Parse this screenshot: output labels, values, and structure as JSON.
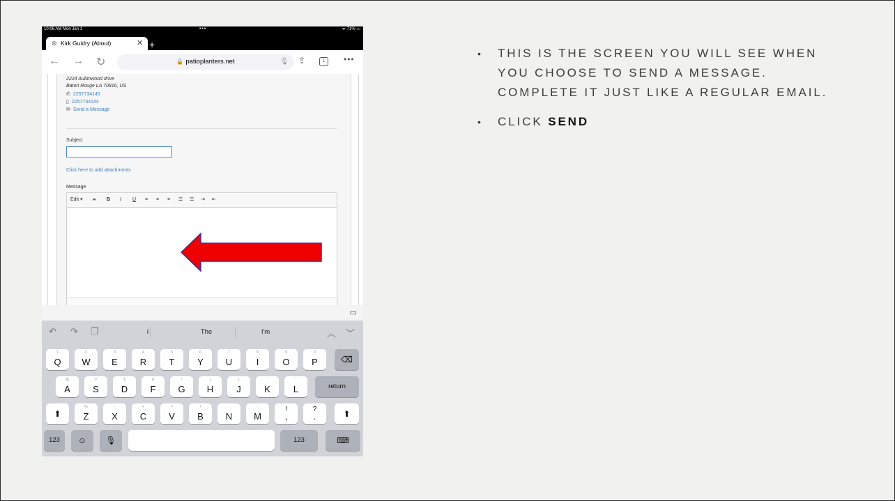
{
  "ipad": {
    "status": {
      "time": "10:06 AM  Mon Jan 1",
      "dots": "•••",
      "battery": "ᯤ 71% ▭"
    },
    "tab": {
      "title": "Kirk Guidry (About)",
      "close": "✕",
      "new_tab": "+"
    },
    "toolbar": {
      "back": "←",
      "forward": "→",
      "reload": "↻",
      "url": "patioplanters.net",
      "lock": "🔒",
      "mic": "🎙",
      "share": "⇪",
      "tab_count": "1",
      "more": "•••"
    },
    "contact": {
      "address_line1": "2224 Aubinwood drive",
      "address_line2": "Baton Rouge LA 70816, US",
      "phone": "2257734145",
      "mobile": "2257734144",
      "send_message": "Send a Message",
      "phone_icon": "✆",
      "mobile_icon": "▯",
      "mail_icon": "✉"
    },
    "form": {
      "subject_label": "Subject",
      "subject_value": "",
      "attach_link": "Click here to add attachments",
      "message_label": "Message",
      "edit_menu": "Edit ▾",
      "format_buttons": [
        "⨯̶",
        "B",
        "I",
        "U",
        "≡",
        "≡",
        "≡",
        "☰",
        "☰",
        "⇥",
        "⇤"
      ]
    },
    "keyboard": {
      "strip_icon": "▭",
      "undo": "↶",
      "redo": "↷",
      "paste": "❐",
      "suggestions": [
        "I",
        "The",
        "I'm"
      ],
      "nav_up": "︿",
      "nav_down": "﹀",
      "row1": [
        {
          "hint": "1",
          "key": "Q"
        },
        {
          "hint": "2",
          "key": "W"
        },
        {
          "hint": "3",
          "key": "E"
        },
        {
          "hint": "4",
          "key": "R"
        },
        {
          "hint": "5",
          "key": "T"
        },
        {
          "hint": "6",
          "key": "Y"
        },
        {
          "hint": "7",
          "key": "U"
        },
        {
          "hint": "8",
          "key": "I"
        },
        {
          "hint": "9",
          "key": "O"
        },
        {
          "hint": "0",
          "key": "P"
        }
      ],
      "delete": "⌫",
      "row2": [
        {
          "hint": "@",
          "key": "A"
        },
        {
          "hint": "#",
          "key": "S"
        },
        {
          "hint": "$",
          "key": "D"
        },
        {
          "hint": "&",
          "key": "F"
        },
        {
          "hint": "*",
          "key": "G"
        },
        {
          "hint": "(",
          "key": "H"
        },
        {
          "hint": ")",
          "key": "J"
        },
        {
          "hint": "'",
          "key": "K"
        },
        {
          "hint": "\"",
          "key": "L"
        }
      ],
      "return": "return",
      "row3": [
        {
          "hint": "%",
          "key": "Z"
        },
        {
          "hint": "-",
          "key": "X"
        },
        {
          "hint": "+",
          "key": "C"
        },
        {
          "hint": "=",
          "key": "V"
        },
        {
          "hint": "/",
          "key": "B"
        },
        {
          "hint": ";",
          "key": "N"
        },
        {
          "hint": ":",
          "key": "M"
        },
        {
          "hint": "!",
          "key": ","
        },
        {
          "hint": "?",
          "key": "."
        }
      ],
      "shift": "⬆",
      "numbers": "123",
      "emoji": "☺",
      "dictation": "🎙",
      "hide": "⌨"
    }
  },
  "bullets": [
    {
      "text": "THIS IS THE SCREEN YOU WILL SEE WHEN YOU CHOOSE TO SEND A MESSAGE. COMPLETE IT JUST LIKE A REGULAR EMAIL."
    },
    {
      "prefix": "CLICK ",
      "emphasis": "SEND"
    }
  ],
  "colors": {
    "slide_bg": "#f1f2f0",
    "arrow_fill": "#ee0000",
    "arrow_outline": "#3d2f8f",
    "link": "#3a7dbf"
  }
}
